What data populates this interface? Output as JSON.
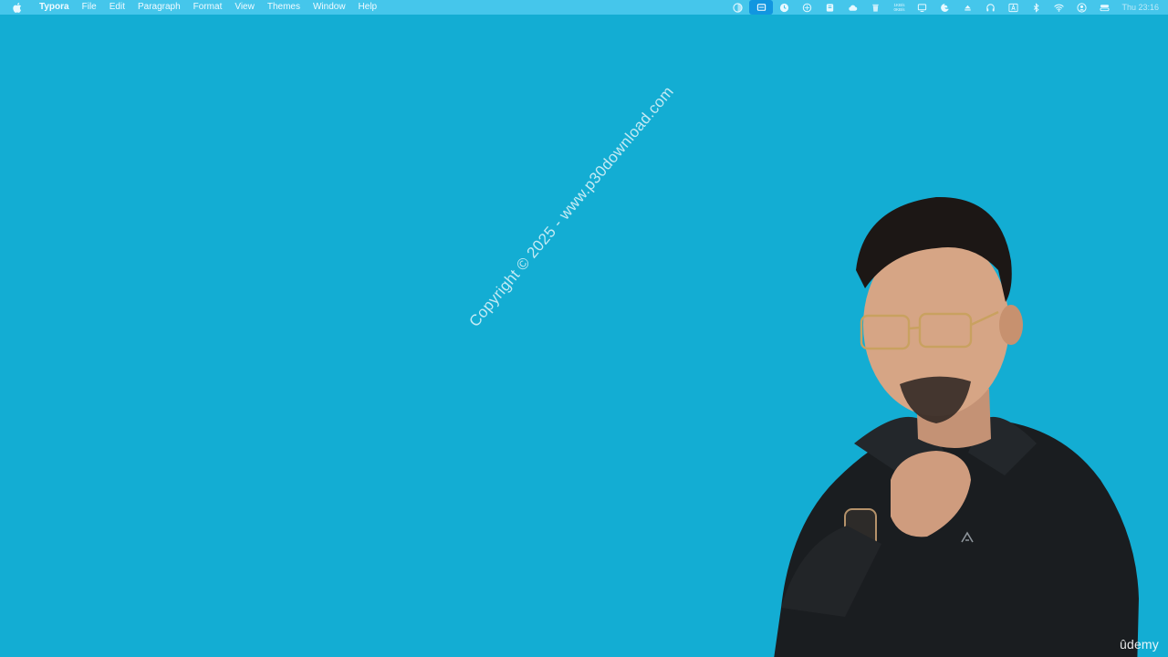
{
  "menubar": {
    "app_name": "Typora",
    "items": [
      "File",
      "Edit",
      "Paragraph",
      "Format",
      "View",
      "Themes",
      "Window",
      "Help"
    ],
    "stats_line1": "1KB/s",
    "stats_line2": "0KB/s",
    "clock": "Thu 23:16"
  },
  "desktop": {
    "background_color": "#13add3",
    "watermark": "Copyright © 2025 - www.p30download.com",
    "logo": "ûdemy"
  },
  "colors": {
    "menubar_bg": "#45c6eb",
    "active_tray": "#1196e0"
  }
}
